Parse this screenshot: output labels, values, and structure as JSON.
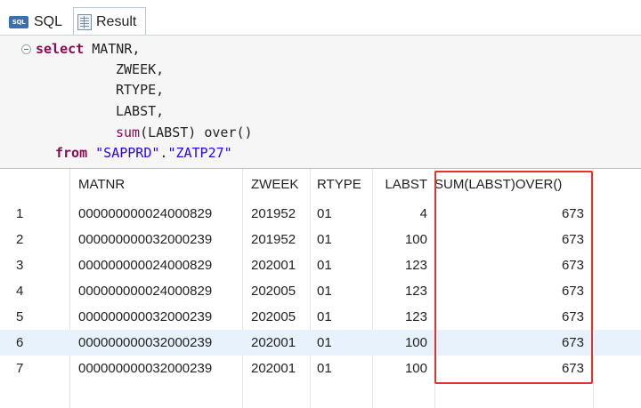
{
  "tabs": [
    {
      "label": "SQL"
    },
    {
      "label": "Result"
    }
  ],
  "editor": {
    "lines": [
      {
        "parts": [
          {
            "t": "select",
            "c": "kw"
          },
          {
            "t": " MATNR,",
            "c": ""
          }
        ]
      },
      {
        "parts": [
          {
            "t": "ZWEEK,",
            "c": ""
          }
        ]
      },
      {
        "parts": [
          {
            "t": "RTYPE,",
            "c": ""
          }
        ]
      },
      {
        "parts": [
          {
            "t": "LABST,",
            "c": ""
          }
        ]
      },
      {
        "parts": [
          {
            "t": "sum",
            "c": "fn"
          },
          {
            "t": "(LABST) over()",
            "c": ""
          }
        ]
      },
      {
        "parts": [
          {
            "t": "from",
            "c": "kw"
          },
          {
            "t": " ",
            "c": ""
          },
          {
            "t": "\"SAPPRD\"",
            "c": "str"
          },
          {
            "t": ".",
            "c": ""
          },
          {
            "t": "\"ZATP27\"",
            "c": "str"
          }
        ]
      }
    ]
  },
  "grid": {
    "columns": [
      "",
      "MATNR",
      "ZWEEK",
      "RTYPE",
      "LABST",
      "SUM(LABST)OVER()"
    ],
    "rows": [
      [
        "1",
        "000000000024000829",
        "201952",
        "01",
        "4",
        "673"
      ],
      [
        "2",
        "000000000032000239",
        "201952",
        "01",
        "100",
        "673"
      ],
      [
        "3",
        "000000000024000829",
        "202001",
        "01",
        "123",
        "673"
      ],
      [
        "4",
        "000000000024000829",
        "202005",
        "01",
        "123",
        "673"
      ],
      [
        "5",
        "000000000032000239",
        "202005",
        "01",
        "123",
        "673"
      ],
      [
        "6",
        "000000000032000239",
        "202001",
        "01",
        "100",
        "673"
      ],
      [
        "7",
        "000000000032000239",
        "202001",
        "01",
        "100",
        "673"
      ]
    ],
    "selected_row": 6,
    "highlight_color": "#e0342c",
    "selection_color": "#e8f2fc"
  }
}
